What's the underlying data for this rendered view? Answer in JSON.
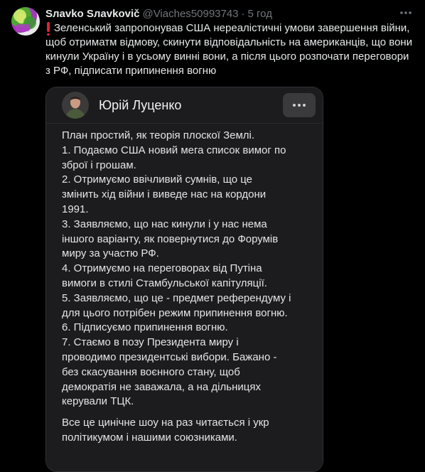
{
  "tweet": {
    "display_name": "Sлavko Sлavkovič",
    "handle": "@Viaches50993743",
    "separator": "·",
    "time": "5 год",
    "text": "Зеленський запропонував США нереалістичні умови завершення війни, щоб отриматм відмову, скинути відповідальність на американців, що вони кинули Україну і в усьому винні вони, а після цього розпочати переговори з РФ, підписати припинення вогню"
  },
  "embedded_post": {
    "author_name": "Юрій Луценко",
    "lines": [
      "План простий, як теорія плоскої Землі.",
      "1. Подаємо США новий мега список вимог по",
      "зброї і грошам.",
      "2. Отримуємо ввічливий сумнів, що це",
      "змінить хід війни і виведе нас на кордони",
      "1991.",
      "3. Заявляємо, що нас кинули і у нас нема",
      "іншого варіанту, як повернутися до Форумів",
      "миру за участю РФ.",
      "4. Отримуємо на переговорах від Путіна",
      "вимоги в стилі Стамбульської капітуляції.",
      "5. Заявляємо, що це - предмет референдуму і",
      "для цього потрібен режим припинення вогню.",
      "6. Підписуємо припинення вогню.",
      "7. Стаємо в позу Президента миру і",
      "проводимо президентські вибори. Бажано -",
      "без скасування воєнного стану, щоб",
      "демократія не заважала, а на дільницях",
      "керували ТЦК."
    ],
    "closing_lines": [
      "Все це цинічне шоу на раз читається і укр",
      "політикумом і нашими союзниками."
    ]
  },
  "colors": {
    "background": "#000000",
    "text": "#e7e9ea",
    "muted": "#71767b",
    "card_bg": "#1c1c1e",
    "alert_red": "#e0243a"
  },
  "icons": {
    "tweet_more": "more-horizontal-icon",
    "card_more": "more-horizontal-icon",
    "alert": "exclamation-icon"
  }
}
